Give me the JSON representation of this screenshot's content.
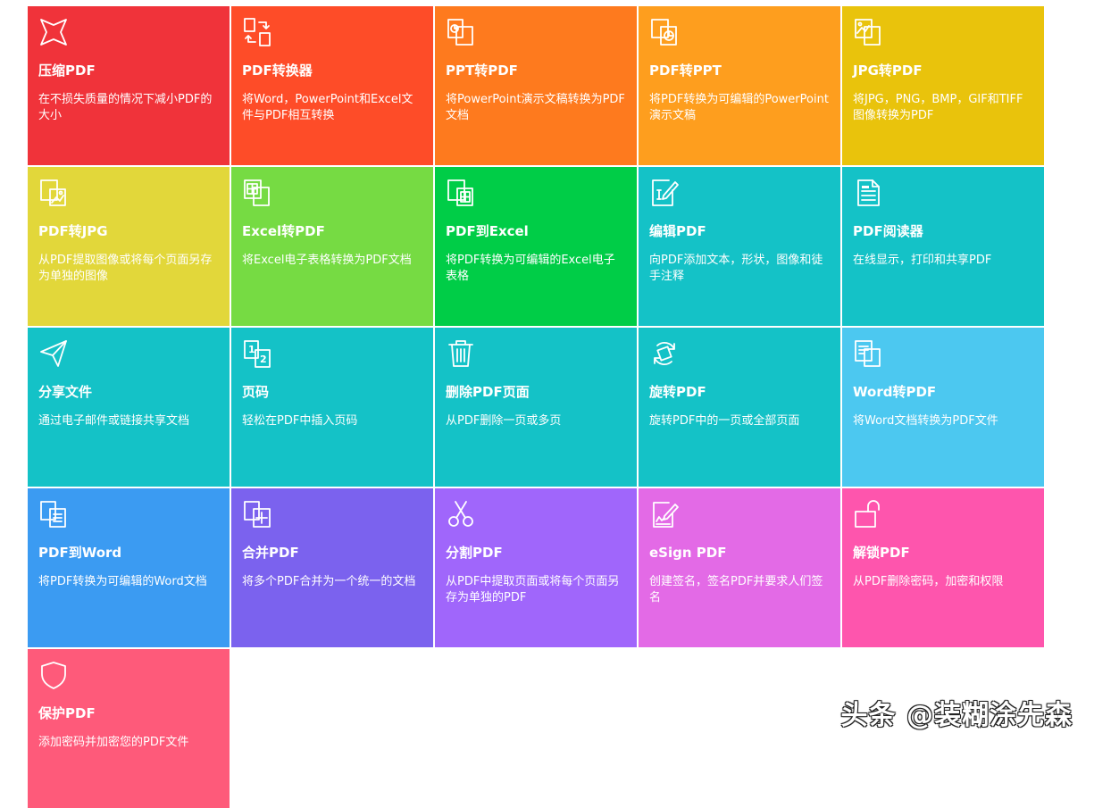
{
  "tools": [
    {
      "title": "压缩PDF",
      "desc": "在不损失质量的情况下减小PDF的大小",
      "color": "#F0333A",
      "icon": "compress-icon"
    },
    {
      "title": "PDF转换器",
      "desc": "将Word，PowerPoint和Excel文件与PDF相互转换",
      "color": "#FE4C28",
      "icon": "convert-icon"
    },
    {
      "title": "PPT转PDF",
      "desc": "将PowerPoint演示文稿转换为PDF文档",
      "color": "#FE7A1E",
      "icon": "ppt-to-pdf-icon"
    },
    {
      "title": "PDF转PPT",
      "desc": "将PDF转换为可编辑的PowerPoint演示文稿",
      "color": "#FE9E1E",
      "icon": "pdf-to-ppt-icon"
    },
    {
      "title": "JPG转PDF",
      "desc": "将JPG，PNG，BMP，GIF和TIFF图像转换为PDF",
      "color": "#E9C30C",
      "icon": "jpg-to-pdf-icon"
    },
    {
      "title": "PDF转JPG",
      "desc": "从PDF提取图像或将每个页面另存为单独的图像",
      "color": "#E2D73A",
      "icon": "pdf-to-jpg-icon"
    },
    {
      "title": "Excel转PDF",
      "desc": "将Excel电子表格转换为PDF文档",
      "color": "#76DB43",
      "icon": "excel-to-pdf-icon"
    },
    {
      "title": "PDF到Excel",
      "desc": "将PDF转换为可编辑的Excel电子表格",
      "color": "#00CD47",
      "icon": "pdf-to-excel-icon"
    },
    {
      "title": "编辑PDF",
      "desc": "向PDF添加文本，形状，图像和徒手注释",
      "color": "#14C2C7",
      "icon": "edit-icon"
    },
    {
      "title": "PDF阅读器",
      "desc": "在线显示，打印和共享PDF",
      "color": "#14C2C7",
      "icon": "reader-icon"
    },
    {
      "title": "分享文件",
      "desc": "通过电子邮件或链接共享文档",
      "color": "#14C2C7",
      "icon": "share-icon"
    },
    {
      "title": "页码",
      "desc": "轻松在PDF中插入页码",
      "color": "#14C2C7",
      "icon": "page-number-icon"
    },
    {
      "title": "删除PDF页面",
      "desc": "从PDF删除一页或多页",
      "color": "#14C2C7",
      "icon": "trash-icon"
    },
    {
      "title": "旋转PDF",
      "desc": "旋转PDF中的一页或全部页面",
      "color": "#14C2C7",
      "icon": "rotate-icon"
    },
    {
      "title": "Word转PDF",
      "desc": "将Word文档转换为PDF文件",
      "color": "#4CC8F0",
      "icon": "word-to-pdf-icon"
    },
    {
      "title": "PDF到Word",
      "desc": "将PDF转换为可编辑的Word文档",
      "color": "#3B9BF2",
      "icon": "pdf-to-word-icon"
    },
    {
      "title": "合并PDF",
      "desc": "将多个PDF合并为一个统一的文档",
      "color": "#7B62EE",
      "icon": "merge-icon"
    },
    {
      "title": "分割PDF",
      "desc": "从PDF中提取页面或将每个页面另存为单独的PDF",
      "color": "#A066FB",
      "icon": "scissors-icon"
    },
    {
      "title": "eSign PDF",
      "desc": "创建签名，签名PDF并要求人们签名",
      "color": "#E36AE6",
      "icon": "esign-icon"
    },
    {
      "title": "解锁PDF",
      "desc": "从PDF删除密码，加密和权限",
      "color": "#FE55AD",
      "icon": "unlock-icon"
    },
    {
      "title": "保护PDF",
      "desc": "添加密码并加密您的PDF文件",
      "color": "#FE5A7A",
      "icon": "shield-icon"
    }
  ],
  "watermark": "头条 @装糊涂先森"
}
